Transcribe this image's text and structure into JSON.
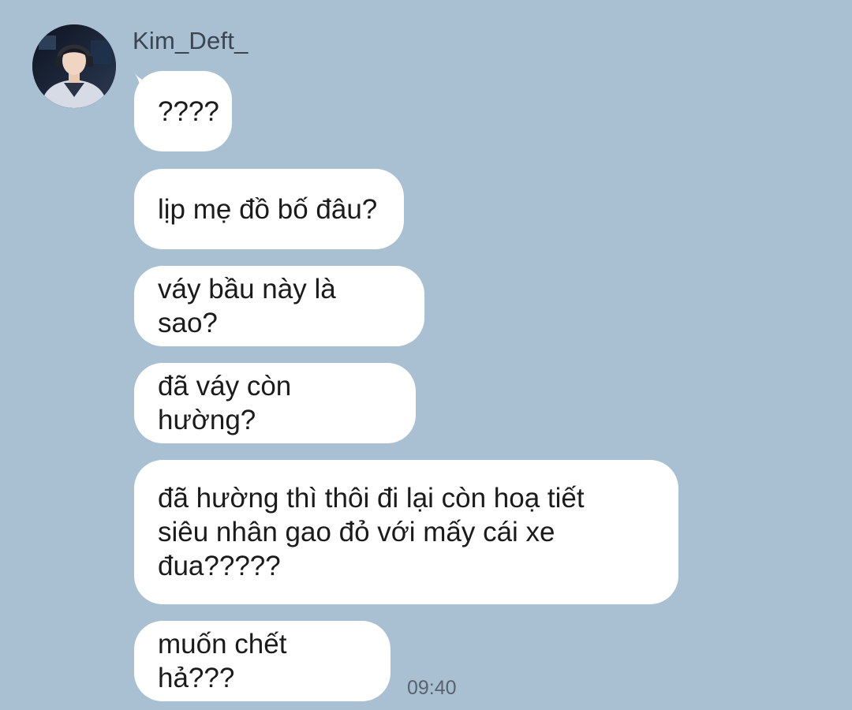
{
  "sender": {
    "name": "Kim_Deft_",
    "avatar_icon": "user-avatar-photo"
  },
  "messages": [
    {
      "text": "????"
    },
    {
      "text": "lịp mẹ đồ bố đâu?"
    },
    {
      "text": "váy bầu này là sao?"
    },
    {
      "text": "đã váy còn hường?"
    },
    {
      "text": "đã hường thì thôi đi lại còn hoạ tiết\nsiêu nhân gao đỏ với mấy cái xe\nđua?????"
    },
    {
      "text": "muốn chết hả???"
    }
  ],
  "timestamp": "09:40",
  "colors": {
    "background": "#a9bfd2",
    "bubble": "#ffffff"
  }
}
